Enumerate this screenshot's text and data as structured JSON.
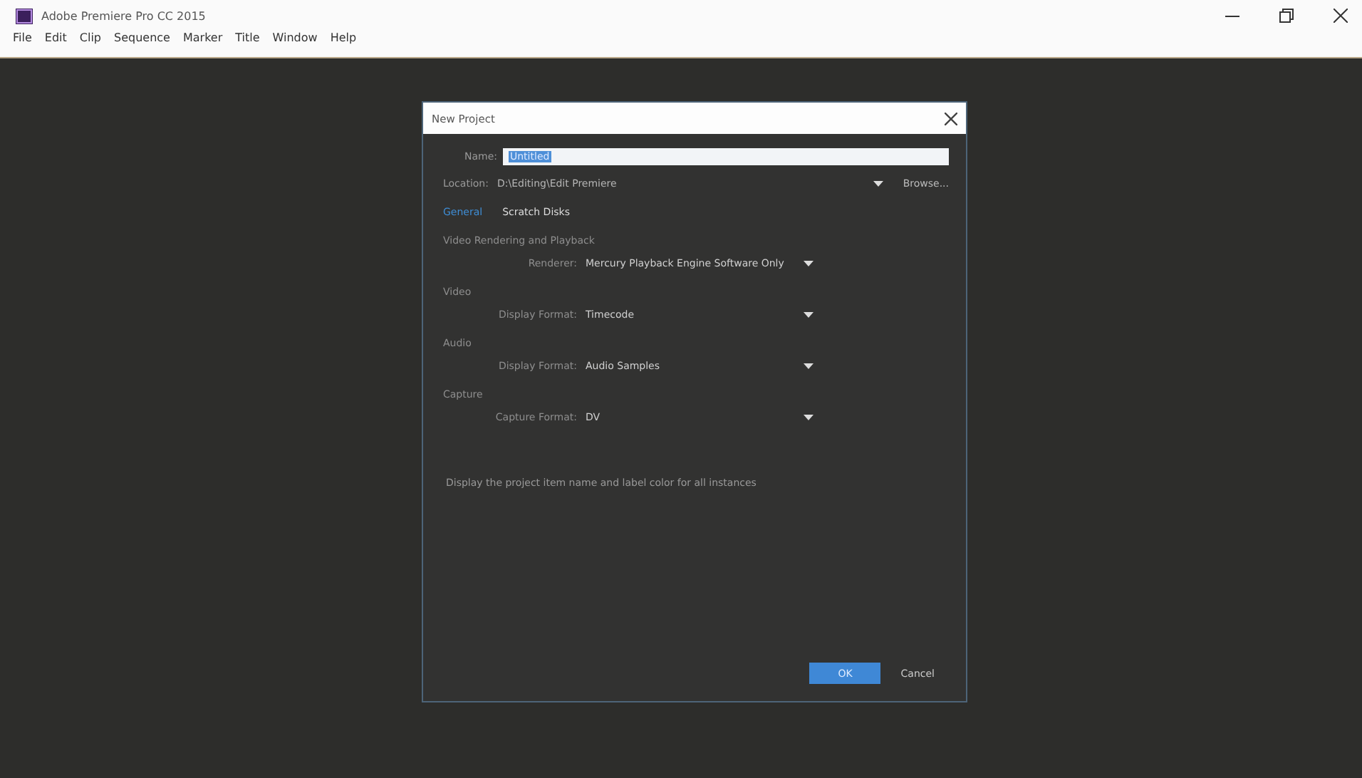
{
  "window": {
    "title": "Adobe Premiere Pro CC 2015"
  },
  "menu": [
    "File",
    "Edit",
    "Clip",
    "Sequence",
    "Marker",
    "Title",
    "Window",
    "Help"
  ],
  "dialog": {
    "title": "New Project",
    "name": {
      "label": "Name:",
      "value": "Untitled",
      "selected": true
    },
    "location": {
      "label": "Location:",
      "value": "D:\\Editing\\Edit Premiere",
      "browse": "Browse..."
    },
    "tabs": [
      {
        "label": "General",
        "selected": true
      },
      {
        "label": "Scratch Disks",
        "selected": false
      }
    ],
    "sections": [
      {
        "heading": "Video Rendering and Playback",
        "field": {
          "label": "Renderer:",
          "value": "Mercury Playback Engine Software Only"
        }
      },
      {
        "heading": "Video",
        "field": {
          "label": "Display Format:",
          "value": "Timecode"
        }
      },
      {
        "heading": "Audio",
        "field": {
          "label": "Display Format:",
          "value": "Audio Samples"
        }
      },
      {
        "heading": "Capture",
        "field": {
          "label": "Capture Format:",
          "value": "DV"
        }
      }
    ],
    "option": "Display the project item name and label color for all instances",
    "buttons": [
      {
        "label": "OK",
        "kind": "primary"
      },
      {
        "label": "Cancel",
        "kind": "plain"
      }
    ]
  }
}
